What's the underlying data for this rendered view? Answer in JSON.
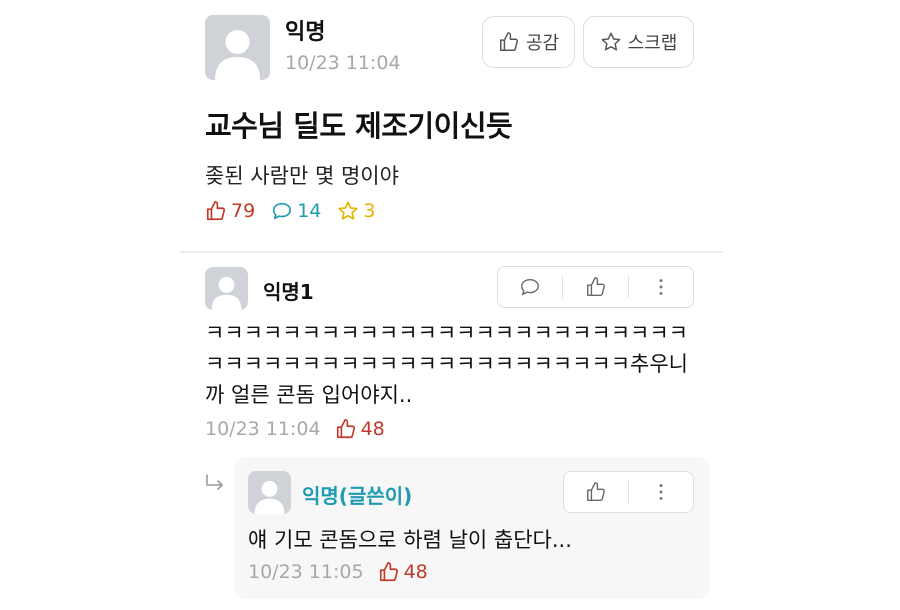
{
  "post": {
    "author": "익명",
    "time": "10/23 11:04",
    "like_button_label": "공감",
    "scrap_button_label": "스크랩",
    "title": "교수님 딜도 제조기이신듯",
    "body": "좆된 사람만 몇 명이야",
    "stats": {
      "likes": "79",
      "comments": "14",
      "scraps": "3"
    }
  },
  "comments": [
    {
      "author": "익명1",
      "text": "ㅋㅋㅋㅋㅋㅋㅋㅋㅋㅋㅋㅋㅋㅋㅋㅋㅋㅋㅋㅋㅋㅋㅋㅋㅋㅋㅋㅋㅋㅋㅋㅋㅋㅋㅋㅋㅋㅋㅋㅋㅋㅋㅋㅋㅋㅋㅋ추우니까 얼른 콘돔 입어야지..",
      "time": "10/23 11:04",
      "likes": "48"
    }
  ],
  "reply": {
    "author": "익명(글쓴이)",
    "text": "얘 기모 콘돔으로 하렴 날이 춥단다...",
    "time": "10/23 11:05",
    "likes": "48"
  },
  "colors": {
    "like": "#c0392b",
    "comment": "#1e9bb1",
    "scrap": "#e0b500",
    "author_highlight": "#1e9bb1",
    "timestamp": "#a8a8a8"
  },
  "icons": [
    "person-avatar-icon",
    "thumbs-up-icon",
    "star-icon",
    "comment-bubble-icon",
    "more-vertical-icon",
    "reply-arrow-icon"
  ]
}
